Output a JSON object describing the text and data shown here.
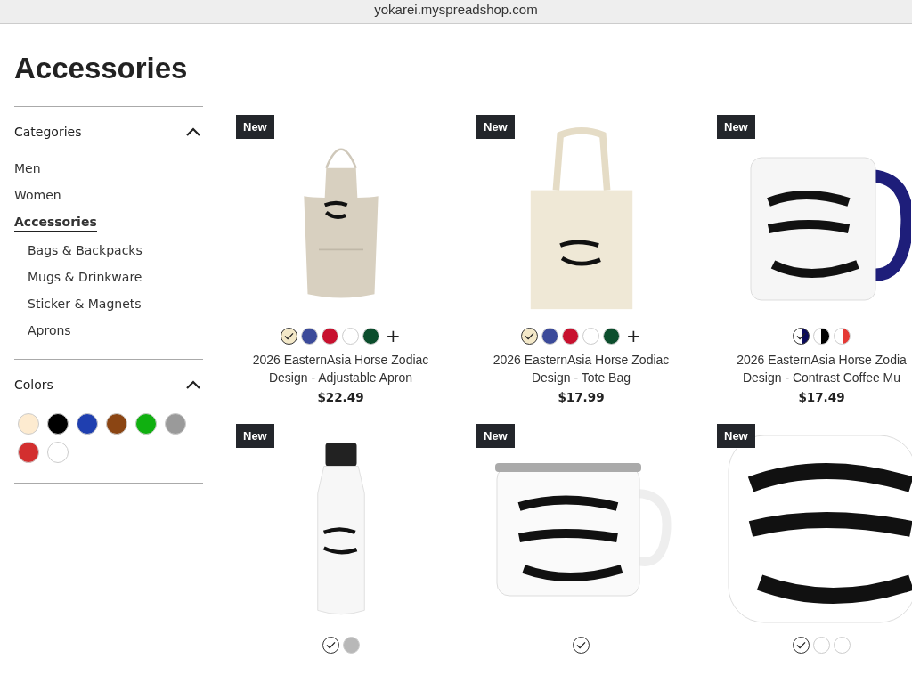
{
  "browser": {
    "url": "yokarei.myspreadshop.com"
  },
  "page": {
    "title": "Accessories"
  },
  "sidebar": {
    "categories": {
      "title": "Categories",
      "expanded": true,
      "items": [
        {
          "label": "Men",
          "selected": false
        },
        {
          "label": "Women",
          "selected": false
        },
        {
          "label": "Accessories",
          "selected": true,
          "children": [
            {
              "label": "Bags & Backpacks",
              "selected": false
            },
            {
              "label": "Mugs & Drinkware",
              "selected": false
            },
            {
              "label": "Sticker & Magnets",
              "selected": false
            },
            {
              "label": "Aprons",
              "selected": false
            }
          ]
        }
      ]
    },
    "colors": {
      "title": "Colors",
      "expanded": true,
      "swatches": [
        {
          "color": "#fdebd0"
        },
        {
          "color": "#000000"
        },
        {
          "color": "#1f3fb0"
        },
        {
          "color": "#8b4513"
        },
        {
          "color": "#10b010"
        },
        {
          "color": "#9a9a9a"
        },
        {
          "color": "#d32f2f"
        },
        {
          "color": "#ffffff"
        }
      ]
    }
  },
  "products": [
    {
      "kind": "apron",
      "badge": "New",
      "title": [
        "2026 EasternAsia Horse Zodiac",
        "Design - Adjustable Apron"
      ],
      "price": "$22.49",
      "more": "+",
      "swatches": [
        {
          "color": "#f3e8c8",
          "selected": true
        },
        {
          "color": "#3b4a9a",
          "selected": false
        },
        {
          "color": "#c8102e",
          "selected": false
        },
        {
          "color": "#ffffff",
          "selected": false
        },
        {
          "color": "#0b4d2c",
          "selected": false
        }
      ]
    },
    {
      "kind": "bag",
      "badge": "New",
      "title": [
        "2026 EasternAsia Horse Zodiac",
        "Design - Tote Bag"
      ],
      "price": "$17.99",
      "more": "+",
      "swatches": [
        {
          "color": "#f3e8c8",
          "selected": true
        },
        {
          "color": "#3b4a9a",
          "selected": false
        },
        {
          "color": "#c8102e",
          "selected": false
        },
        {
          "color": "#ffffff",
          "selected": false
        },
        {
          "color": "#0b4d2c",
          "selected": false
        }
      ]
    },
    {
      "kind": "mug",
      "badge": "New",
      "title": [
        "2026 EasternAsia Horse Zodia",
        "Design - Contrast Coffee Mu"
      ],
      "price": "$17.49",
      "swatches": [
        {
          "color": "#0a0a5a",
          "selected": true
        },
        {
          "color": "#000000",
          "selected": false
        },
        {
          "color": "#e53935",
          "selected": false
        }
      ]
    },
    {
      "kind": "bottle",
      "badge": "New",
      "swatches": [
        {
          "color": "#ffffff",
          "selected": true
        },
        {
          "color": "#b8b8b8",
          "selected": false
        }
      ]
    },
    {
      "kind": "enamel",
      "badge": "New",
      "swatches": [
        {
          "color": "#ffffff",
          "selected": true
        }
      ]
    },
    {
      "kind": "sticker",
      "badge": "New",
      "swatches": [
        {
          "color": "#ffffff",
          "selected": true
        },
        {
          "color": "#ffffff",
          "selected": false
        },
        {
          "color": "#ffffff",
          "selected": false
        }
      ]
    }
  ]
}
